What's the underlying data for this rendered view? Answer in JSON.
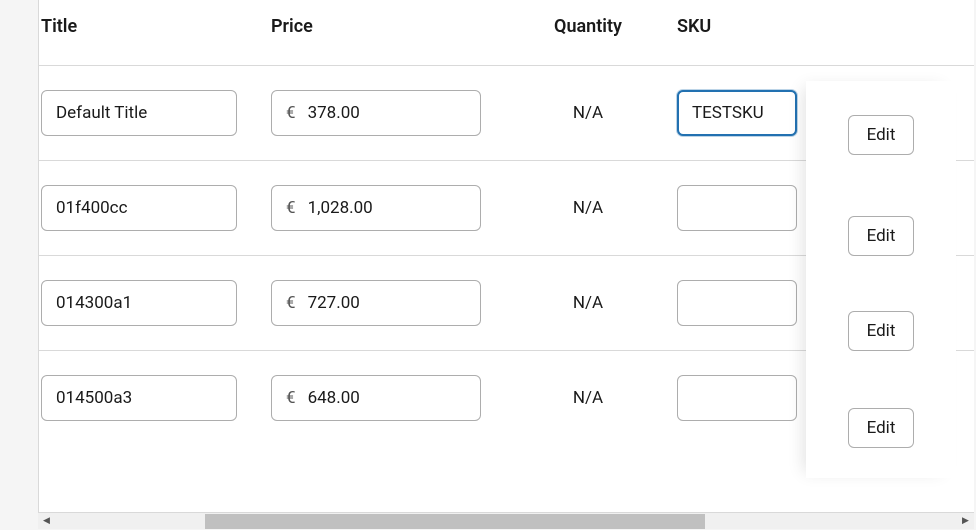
{
  "headers": {
    "title": "Title",
    "price": "Price",
    "quantity": "Quantity",
    "sku": "SKU"
  },
  "currency_symbol": "€",
  "edit_label": "Edit",
  "rows": [
    {
      "title": "Default Title",
      "price": "378.00",
      "quantity": "N/A",
      "sku": "TESTSKU",
      "sku_focused": true
    },
    {
      "title": "01f400cc",
      "price": "1,028.00",
      "quantity": "N/A",
      "sku": "",
      "sku_focused": false
    },
    {
      "title": "014300a1",
      "price": "727.00",
      "quantity": "N/A",
      "sku": "",
      "sku_focused": false
    },
    {
      "title": "014500a3",
      "price": "648.00",
      "quantity": "N/A",
      "sku": "",
      "sku_focused": false
    }
  ]
}
